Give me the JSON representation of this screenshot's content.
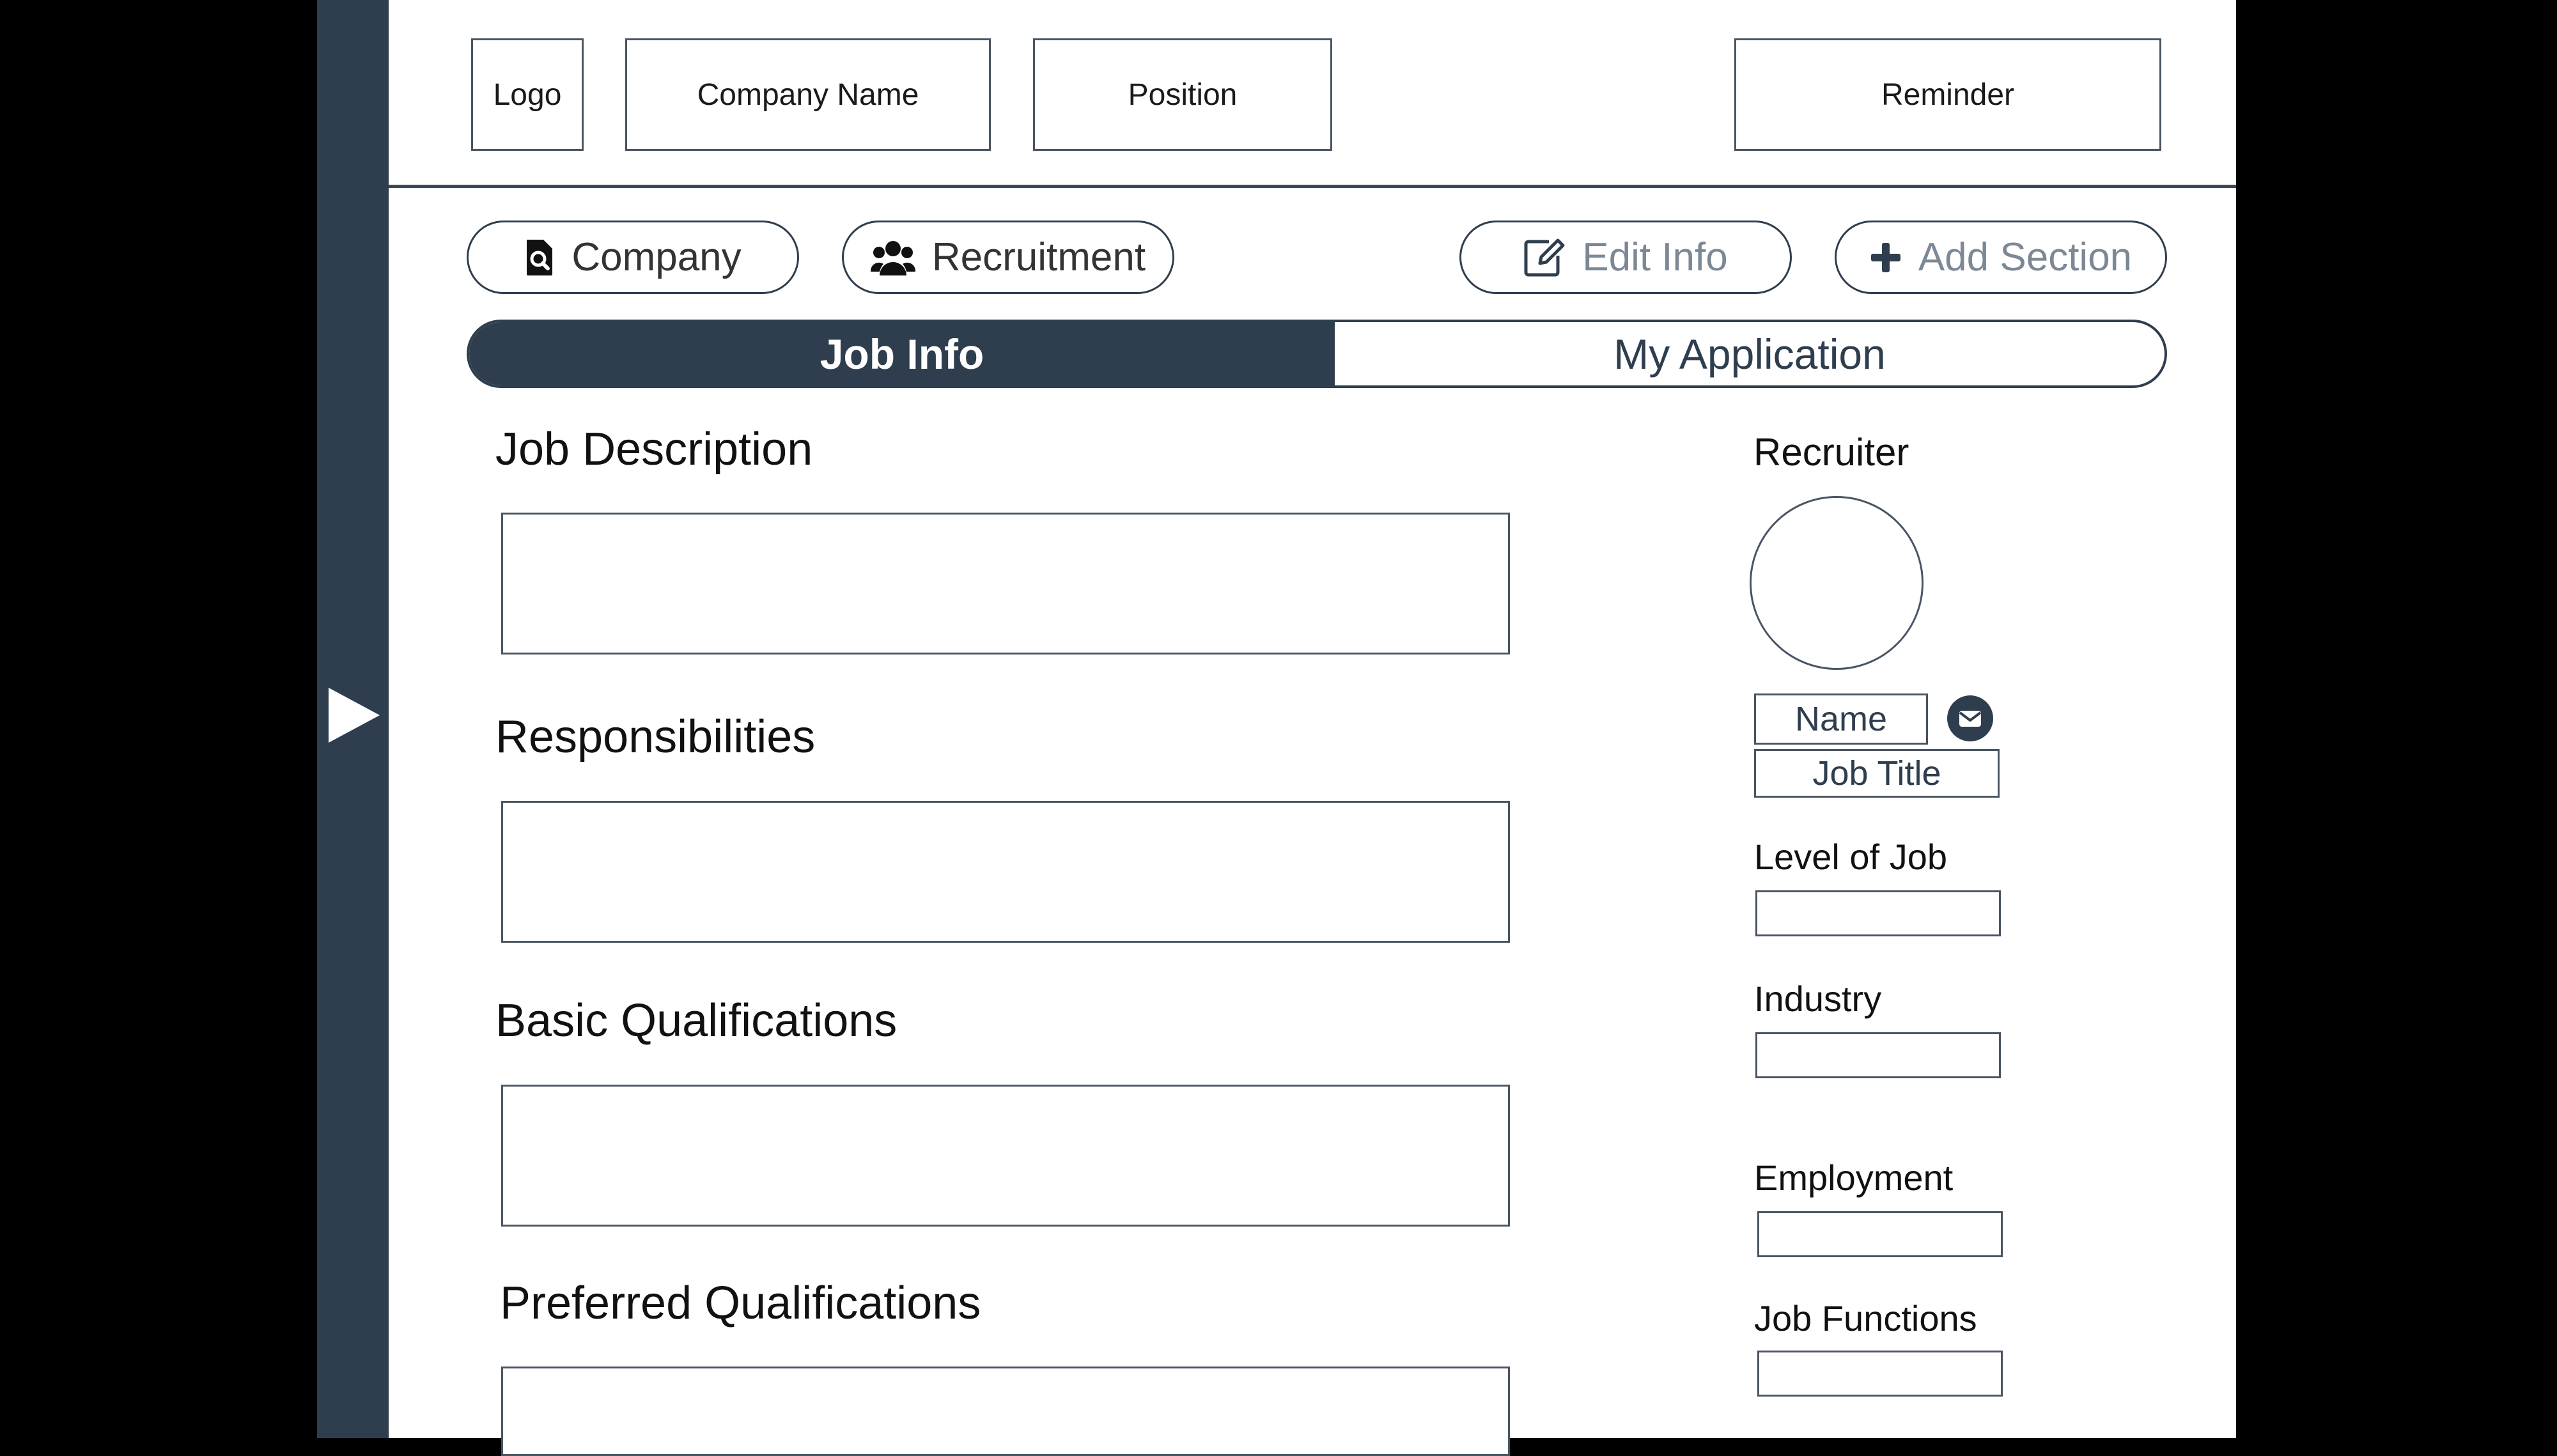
{
  "header": {
    "logo": "Logo",
    "company_name": "Company Name",
    "position": "Position",
    "reminder": "Reminder"
  },
  "actions": {
    "company": {
      "label": "Company",
      "icon": "company-search-icon"
    },
    "recruitment": {
      "label": "Recruitment",
      "icon": "users-icon"
    },
    "edit_info": {
      "label": "Edit Info",
      "icon": "edit-icon"
    },
    "add_section": {
      "label": "Add Section",
      "icon": "plus-icon"
    }
  },
  "tabs": {
    "active": "Job Info",
    "items": [
      {
        "label": "Job Info"
      },
      {
        "label": "My Application"
      }
    ]
  },
  "job_sections": [
    {
      "title": "Job Description"
    },
    {
      "title": "Responsibilities"
    },
    {
      "title": "Basic Qualifications"
    },
    {
      "title": "Preferred Qualifications"
    }
  ],
  "recruiter": {
    "label": "Recruiter",
    "name": "Name",
    "job_title": "Job Title",
    "email_icon": "email-icon"
  },
  "details": [
    {
      "label": "Level of Job"
    },
    {
      "label": "Industry"
    },
    {
      "label": "Employment"
    },
    {
      "label": "Job Functions"
    }
  ],
  "colors": {
    "sidebar": "#2f3e4e",
    "accent": "#2f3e4e",
    "border": "#4a5563",
    "muted_text": "#7d8895",
    "background": "#ffffff",
    "outer": "#000000"
  }
}
